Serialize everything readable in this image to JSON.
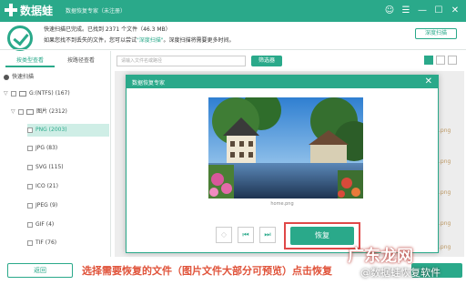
{
  "titlebar": {
    "app_name": "数据蛙",
    "app_subtitle": "数据恢复专家（未注册）",
    "controls": [
      "user-icon",
      "menu-icon",
      "minimize-icon",
      "maximize-icon",
      "close-icon"
    ]
  },
  "scan": {
    "line1": "快速扫描已完成。已找到 2371 个文件（46.3 MB）",
    "line2_prefix": "如果您找不到丢失的文件，您可以尝试",
    "line2_link": "\"深度扫描\"",
    "line2_suffix": "。深度扫描将需要更多时间。",
    "deep_scan_button": "深度扫描"
  },
  "sidebar": {
    "tab_type": "按类型查看",
    "tab_path": "按路径查看",
    "tree": [
      {
        "label": "快速扫描"
      },
      {
        "label": "G:(NTFS) (167)"
      },
      {
        "label": "图片 (2312)"
      },
      {
        "label": "PNG (2003)"
      },
      {
        "label": "JPG (83)"
      },
      {
        "label": "SVG (115)"
      },
      {
        "label": "ICO (21)"
      },
      {
        "label": "JPEG (9)"
      },
      {
        "label": "GIF (4)"
      },
      {
        "label": "TIF (76)"
      }
    ]
  },
  "toolbar": {
    "search_placeholder": "请输入文件名或路径",
    "filter_button": "筛选器"
  },
  "file_exts": [
    ".png",
    ".png",
    ".png",
    ".png",
    ".png"
  ],
  "modal": {
    "title": "数据恢复专家",
    "filename": "home.png",
    "recover_button": "恢复"
  },
  "bottom": {
    "back_button": "返回",
    "caption": "选择需要恢复的文件（图片文件大部分可预览）点击恢复"
  },
  "watermark": {
    "main": "广东龙网",
    "sub": "@数据蛙恢复软件"
  },
  "colors": {
    "accent": "#2aa98a",
    "highlight": "#e04848",
    "caption": "#e0533a"
  }
}
